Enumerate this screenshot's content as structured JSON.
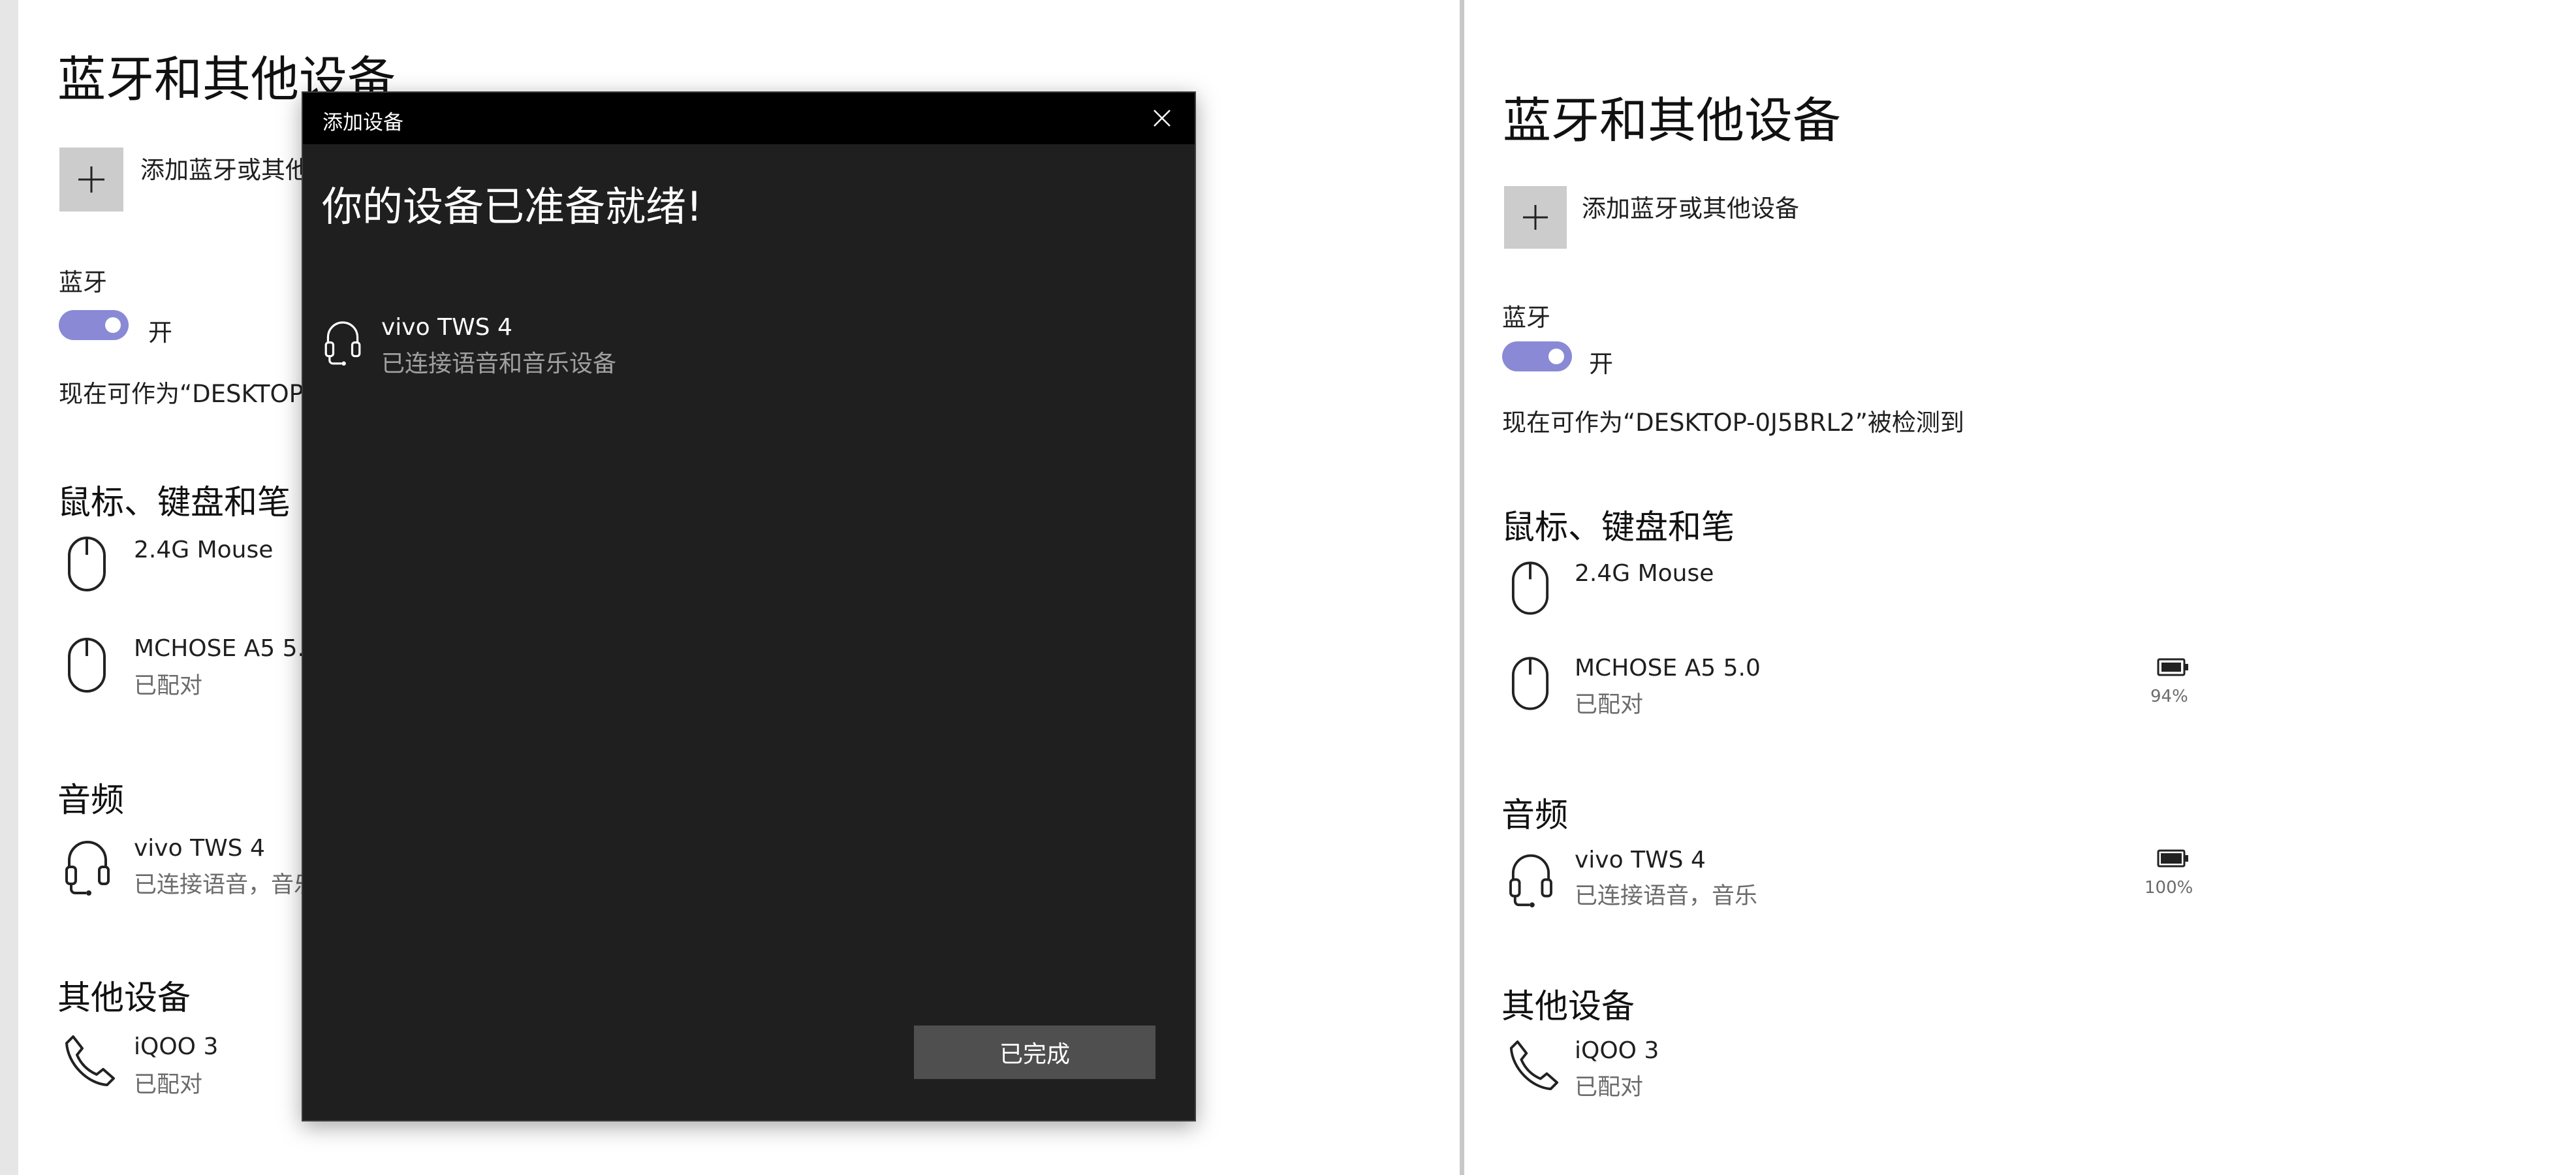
{
  "settings": {
    "page_title": "蓝牙和其他设备",
    "add_device_label": "添加蓝牙或其他设备",
    "bluetooth_heading": "蓝牙",
    "bluetooth_state": "开",
    "discoverable_text": "现在可作为“DESKTOP-0J5BRL2”被检测到",
    "discoverable_text_truncated": "现在可作为“DESKTOP-0J",
    "add_device_label_truncated": "添加蓝牙或其他",
    "sections": {
      "mouse": {
        "heading": "鼠标、键盘和笔",
        "devices": [
          {
            "name": "2.4G Mouse",
            "status": "",
            "battery": ""
          },
          {
            "name": "MCHOSE A5 5.0",
            "status": "已配对",
            "battery": "94%"
          }
        ]
      },
      "audio": {
        "heading": "音频",
        "devices": [
          {
            "name": "vivo TWS 4",
            "status": "已连接语音，音乐",
            "status_truncated": "已连接语音，音乐",
            "battery": "100%"
          }
        ]
      },
      "other": {
        "heading": "其他设备",
        "devices": [
          {
            "name": "iQOO 3",
            "status": "已配对"
          }
        ]
      }
    }
  },
  "dialog": {
    "title": "添加设备",
    "heading": "你的设备已准备就绪!",
    "device_name": "vivo TWS 4",
    "device_status": "已连接语音和音乐设备",
    "done_label": "已完成"
  },
  "icons": {
    "add": "plus-icon",
    "mouse": "mouse-icon",
    "headset": "headset-icon",
    "phone": "phone-icon",
    "battery": "battery-icon",
    "close": "close-icon"
  },
  "colors": {
    "toggle_on": "#8a89d6",
    "dialog_bg": "#1f1f1f",
    "dialog_titlebar": "#000000",
    "done_button": "#4f4f4f",
    "add_tile": "#cccccc"
  }
}
